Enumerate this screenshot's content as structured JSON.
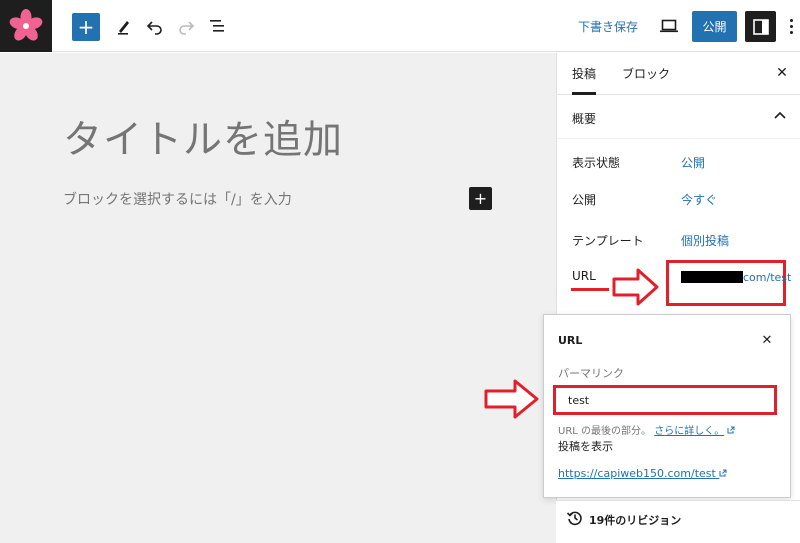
{
  "toolbar": {
    "add_block_label": "+",
    "save_draft_label": "下書き保存",
    "publish_label": "公開"
  },
  "editor": {
    "title_placeholder": "タイトルを追加",
    "block_placeholder": "ブロックを選択するには「/」を入力",
    "inline_add_label": "+"
  },
  "sidebar": {
    "tabs": [
      {
        "label": "投稿",
        "active": true
      },
      {
        "label": "ブロック",
        "active": false
      }
    ],
    "close_label": "✕",
    "panel_title": "概要",
    "rows": [
      {
        "label": "表示状態",
        "value": "公開"
      },
      {
        "label": "公開",
        "value": "今すぐ"
      },
      {
        "label": "テンプレート",
        "value": "個別投稿"
      },
      {
        "label": "URL",
        "value": "com/test"
      }
    ],
    "revisions_label": "19件のリビジョン"
  },
  "url_popover": {
    "title": "URL",
    "close_label": "✕",
    "permalink_label": "パーマリンク",
    "permalink_value": "test",
    "help_text": "URL の最後の部分。",
    "help_link": "さらに詳しく。",
    "view_post_label": "投稿を表示",
    "post_link": "https://capiweb150.com/test"
  },
  "colors": {
    "accent": "#2271b1",
    "annotation": "#e0202a",
    "logo_bg": "#1e1e1e",
    "logo_flower": "#f06292"
  },
  "icons": [
    "sakura-logo-icon",
    "plus-icon",
    "pen-icon",
    "undo-icon",
    "redo-icon",
    "list-view-icon",
    "preview-icon",
    "sidebar-toggle-icon",
    "more-vertical-icon",
    "close-icon",
    "chevron-up-icon",
    "external-link-icon",
    "history-icon"
  ]
}
